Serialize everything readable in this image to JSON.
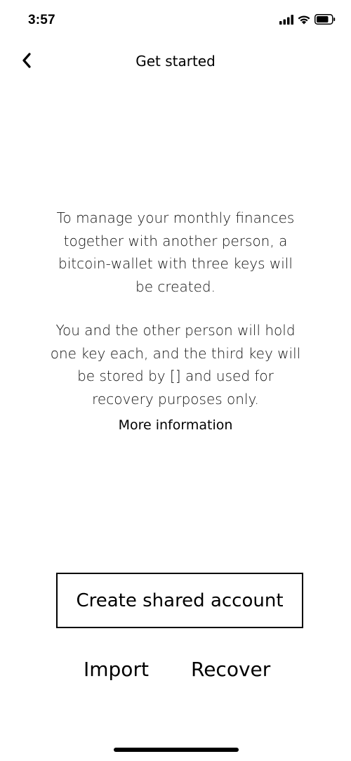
{
  "status_bar": {
    "time": "3:57",
    "icons": [
      "signal-icon",
      "wifi-icon",
      "battery-icon"
    ]
  },
  "nav": {
    "back_icon": "chevron-left-icon",
    "title": "Get started"
  },
  "content": {
    "paragraph_1": "To manage your monthly finances together with another person, a bitcoin-wallet with three keys will be created.",
    "paragraph_2": "You and the other person will hold one key each, and the third key will be stored by [] and used for recovery purposes only.",
    "more_information": "More information"
  },
  "actions": {
    "create_label": "Create shared account",
    "import_label": "Import",
    "recover_label": "Recover"
  }
}
